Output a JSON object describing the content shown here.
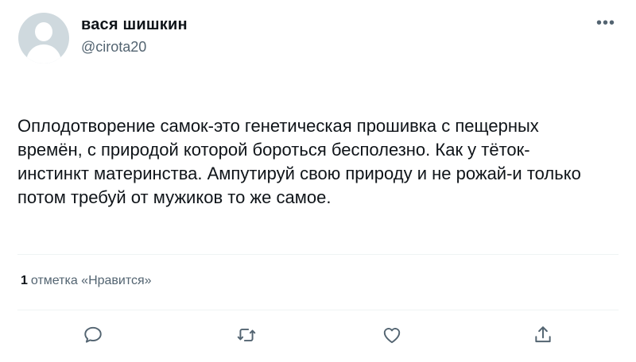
{
  "tweet": {
    "author_name": "вася шишкин",
    "author_handle": "@cirota20",
    "text_lines": [
      "Оплодотворение самок-это генетическая прошивка с пещерных",
      "времён, с природой которой бороться бесполезно. Как у тёток-",
      "инстинкт материнства. Ампутируй свою природу и не рожай-и только",
      "потом требуй от мужиков то же самое."
    ],
    "likes_count": "1",
    "likes_label": "отметка «Нравится»"
  },
  "icons": {
    "more": "more-icon",
    "reply": "reply-icon",
    "retweet": "retweet-icon",
    "like": "like-icon",
    "share": "share-icon"
  },
  "colors": {
    "text": "#0f1419",
    "secondary": "#536471",
    "divider": "#eff3f4",
    "avatar_bg": "#cfd9de"
  }
}
